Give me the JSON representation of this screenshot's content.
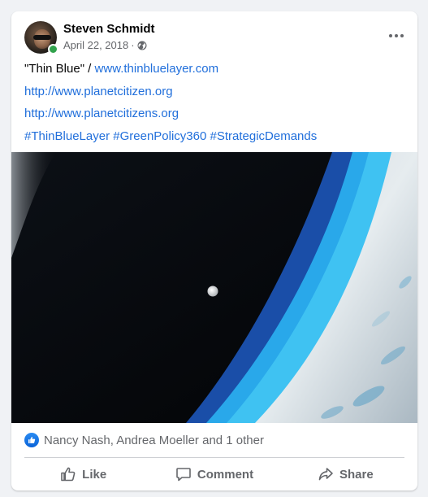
{
  "post": {
    "author": "Steven Schmidt",
    "date": "April 22, 2018",
    "separator": "·",
    "privacy_icon": "globe-icon",
    "menu_icon": "more-options-icon",
    "lines": {
      "title_prefix": "\"Thin Blue\" / ",
      "link1": "www.thinbluelayer.com",
      "link2": "http://www.planetcitizen.org",
      "link3": "http://www.planetcitizens.org",
      "hashtags": [
        "#ThinBlueLayer",
        "#GreenPolicy360",
        "#StrategicDemands"
      ]
    }
  },
  "reactions": {
    "icon": "like-reaction-icon",
    "text": "Nancy Nash, Andrea Moeller and 1 other"
  },
  "actions": {
    "like": "Like",
    "comment": "Comment",
    "share": "Share"
  },
  "colors": {
    "link": "#216fdb",
    "online": "#31a24c",
    "muted": "#65676b",
    "like_badge": "#1877f2"
  }
}
